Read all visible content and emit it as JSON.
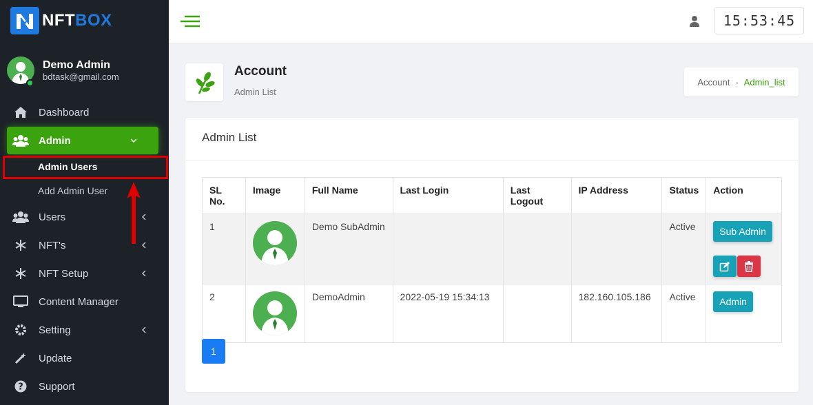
{
  "brand": {
    "name_a": "NFT",
    "name_b": "BOX",
    "accent": "#1f7ae0"
  },
  "profile": {
    "name": "Demo Admin",
    "email": "bdtask@gmail.com"
  },
  "sidebar": {
    "items": [
      {
        "label": "Dashboard",
        "icon": "home-icon"
      },
      {
        "label": "Admin",
        "icon": "users-icon"
      },
      {
        "label": "Users",
        "icon": "users-icon"
      },
      {
        "label": "NFT's",
        "icon": "snowflake-icon"
      },
      {
        "label": "NFT Setup",
        "icon": "snowflake-icon"
      },
      {
        "label": "Content Manager",
        "icon": "monitor-icon"
      },
      {
        "label": "Setting",
        "icon": "gear-icon"
      },
      {
        "label": "Update",
        "icon": "magic-wand-icon"
      },
      {
        "label": "Support",
        "icon": "question-icon"
      }
    ],
    "submenu": [
      {
        "label": "Admin Users"
      },
      {
        "label": "Add Admin User"
      }
    ],
    "active_color": "#3aa30e"
  },
  "topbar": {
    "clock": "15:53:45"
  },
  "page_header": {
    "title": "Account",
    "subtitle": "Admin List"
  },
  "breadcrumb": {
    "parent": "Account",
    "separator": "-",
    "current": "Admin_list"
  },
  "card": {
    "title": "Admin List"
  },
  "table": {
    "headers": [
      "SL No.",
      "Image",
      "Full Name",
      "Last Login",
      "Last Logout",
      "IP Address",
      "Status",
      "Action"
    ],
    "rows": [
      {
        "sl": "1",
        "full_name": "Demo SubAdmin",
        "last_login": "",
        "last_logout": "",
        "ip": "",
        "status": "Active",
        "role_button": "Sub Admin"
      },
      {
        "sl": "2",
        "full_name": "DemoAdmin",
        "last_login": "2022-05-19 15:34:13",
        "last_logout": "",
        "ip": "182.160.105.186",
        "status": "Active",
        "role_button": "Admin"
      }
    ]
  },
  "pagination": {
    "current": "1"
  }
}
